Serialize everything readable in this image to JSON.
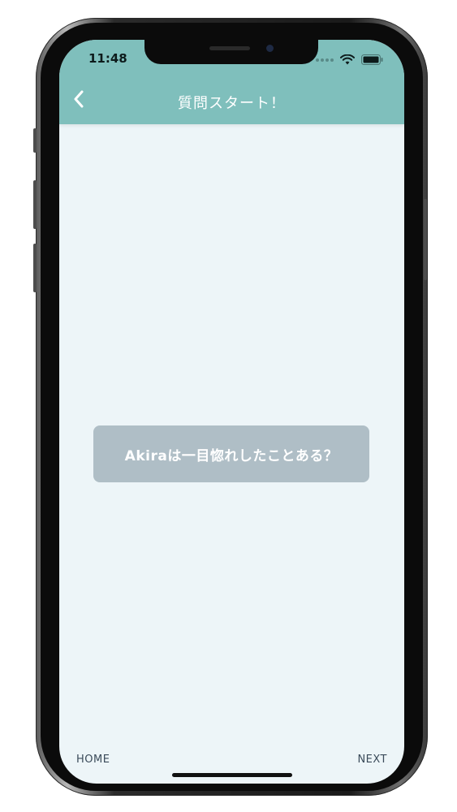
{
  "status_bar": {
    "time": "11:48",
    "icons": [
      "signal-dots-icon",
      "wifi-icon",
      "battery-icon"
    ]
  },
  "header": {
    "title": "質問スタート！",
    "back_icon": "chevron-left-icon",
    "background_color": "#7fbfbc"
  },
  "question": {
    "text": "Akiraは一目惚れしたことある？",
    "card_color": "#afbec6"
  },
  "footer": {
    "home_label": "HOME",
    "next_label": "NEXT"
  },
  "screen_background": "#edf5f8"
}
